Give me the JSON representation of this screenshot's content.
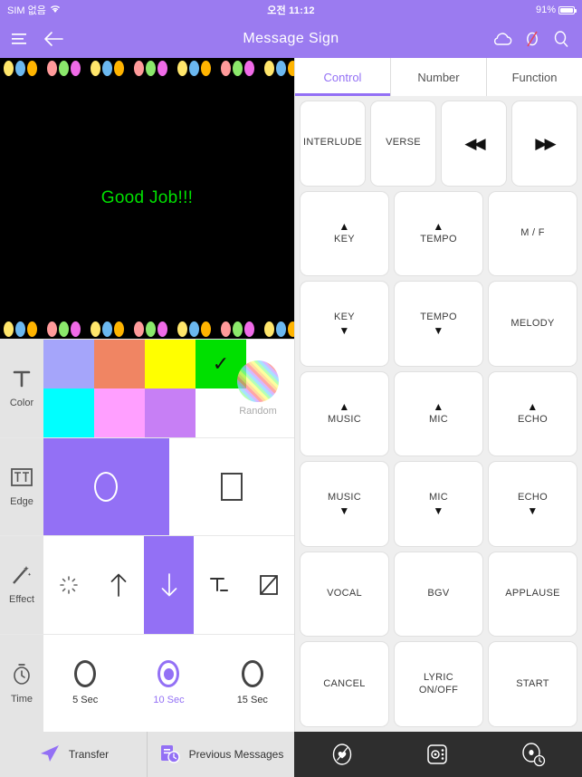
{
  "statusbar": {
    "carrier": "SIM 없음",
    "wifi_icon": "wifi-icon",
    "time": "오전 11:12",
    "battery_percent": "91%",
    "battery_icon": "battery-icon"
  },
  "header": {
    "menu_icon": "hamburger-menu-icon",
    "back_icon": "back-arrow-icon",
    "title": "Message Sign",
    "cloud_icon": "cloud-icon",
    "block_icon": "circle-slash-icon",
    "search_icon": "search-icon",
    "bg_color": "#9B7BF0"
  },
  "display": {
    "message": "Good Job!!!",
    "text_color": "#00E000",
    "background": "#000000",
    "led_colors": [
      "#FFE66B",
      "#6BB8F0",
      "#FFB400",
      "#FF9A9A",
      "#8BE86B",
      "#F06BE8"
    ]
  },
  "editor": {
    "rows": [
      {
        "label": "Color",
        "icon": "text-color-icon",
        "swatches_row1": [
          "#A5A5FA",
          "#F08563",
          "#FFFF00",
          "#00E000"
        ],
        "swatches_row2": [
          "#00FFFF",
          "#FF9FFF",
          "#C77FF5"
        ],
        "selected_index": 3,
        "check_glyph": "✓",
        "random_label": "Random",
        "random_icon": "random-color-icon"
      },
      {
        "label": "Edge",
        "icon": "edge-tt-icon",
        "options": [
          {
            "name": "oval-edge-option",
            "selected": true
          },
          {
            "name": "rect-edge-option",
            "selected": false
          }
        ]
      },
      {
        "label": "Effect",
        "icon": "magic-wand-icon",
        "options": [
          {
            "name": "sparkle-effect-option",
            "glyph": "✳",
            "selected": false
          },
          {
            "name": "scroll-up-effect-option",
            "glyph": "↑",
            "selected": false
          },
          {
            "name": "scroll-down-effect-option",
            "glyph": "↓",
            "selected": true
          },
          {
            "name": "text-underline-effect-option",
            "glyph": "T",
            "selected": false
          },
          {
            "name": "slash-box-effect-option",
            "glyph": "▨",
            "selected": false
          }
        ]
      },
      {
        "label": "Time",
        "icon": "stopwatch-icon",
        "options": [
          {
            "label": "5 Sec",
            "selected": false
          },
          {
            "label": "10 Sec",
            "selected": true
          },
          {
            "label": "15 Sec",
            "selected": false
          }
        ]
      }
    ]
  },
  "panel": {
    "tabs": [
      {
        "label": "Control",
        "active": true
      },
      {
        "label": "Number",
        "active": false
      },
      {
        "label": "Function",
        "active": false
      }
    ],
    "rows": [
      [
        {
          "label": "INTERLUDE",
          "name": "interlude-button"
        },
        {
          "label": "VERSE",
          "name": "verse-button"
        },
        {
          "label": "◀◀",
          "name": "rewind-button",
          "style": "nav"
        },
        {
          "label": "▶▶",
          "name": "fastforward-button",
          "style": "nav"
        }
      ],
      [
        {
          "label": "KEY",
          "name": "key-up-button",
          "top": "▲"
        },
        {
          "label": "TEMPO",
          "name": "tempo-up-button",
          "top": "▲"
        },
        {
          "label": "M / F",
          "name": "male-female-button"
        }
      ],
      [
        {
          "label": "KEY",
          "name": "key-down-button",
          "bottom": "▼"
        },
        {
          "label": "TEMPO",
          "name": "tempo-down-button",
          "bottom": "▼"
        },
        {
          "label": "MELODY",
          "name": "melody-button"
        }
      ],
      [
        {
          "label": "MUSIC",
          "name": "music-up-button",
          "top": "▲"
        },
        {
          "label": "MIC",
          "name": "mic-up-button",
          "top": "▲"
        },
        {
          "label": "ECHO",
          "name": "echo-up-button",
          "top": "▲"
        }
      ],
      [
        {
          "label": "MUSIC",
          "name": "music-down-button",
          "bottom": "▼"
        },
        {
          "label": "MIC",
          "name": "mic-down-button",
          "bottom": "▼"
        },
        {
          "label": "ECHO",
          "name": "echo-down-button",
          "bottom": "▼"
        }
      ],
      [
        {
          "label": "VOCAL",
          "name": "vocal-button"
        },
        {
          "label": "BGV",
          "name": "bgv-button"
        },
        {
          "label": "APPLAUSE",
          "name": "applause-button"
        }
      ],
      [
        {
          "label": "CANCEL",
          "name": "cancel-button"
        },
        {
          "label": "LYRIC\nON/OFF",
          "name": "lyric-onoff-button"
        },
        {
          "label": "START",
          "name": "start-button"
        }
      ]
    ]
  },
  "bottombar": {
    "left_items": [
      {
        "label": "Transfer",
        "icon": "send-paper-plane-icon",
        "name": "transfer-button"
      },
      {
        "label": "Previous Messages",
        "icon": "message-history-icon",
        "name": "previous-messages-button"
      }
    ],
    "right_icons": [
      {
        "name": "favorite-heart-icon"
      },
      {
        "name": "remote-control-icon"
      },
      {
        "name": "recent-disc-icon"
      }
    ],
    "accent_color": "#9370F5"
  }
}
